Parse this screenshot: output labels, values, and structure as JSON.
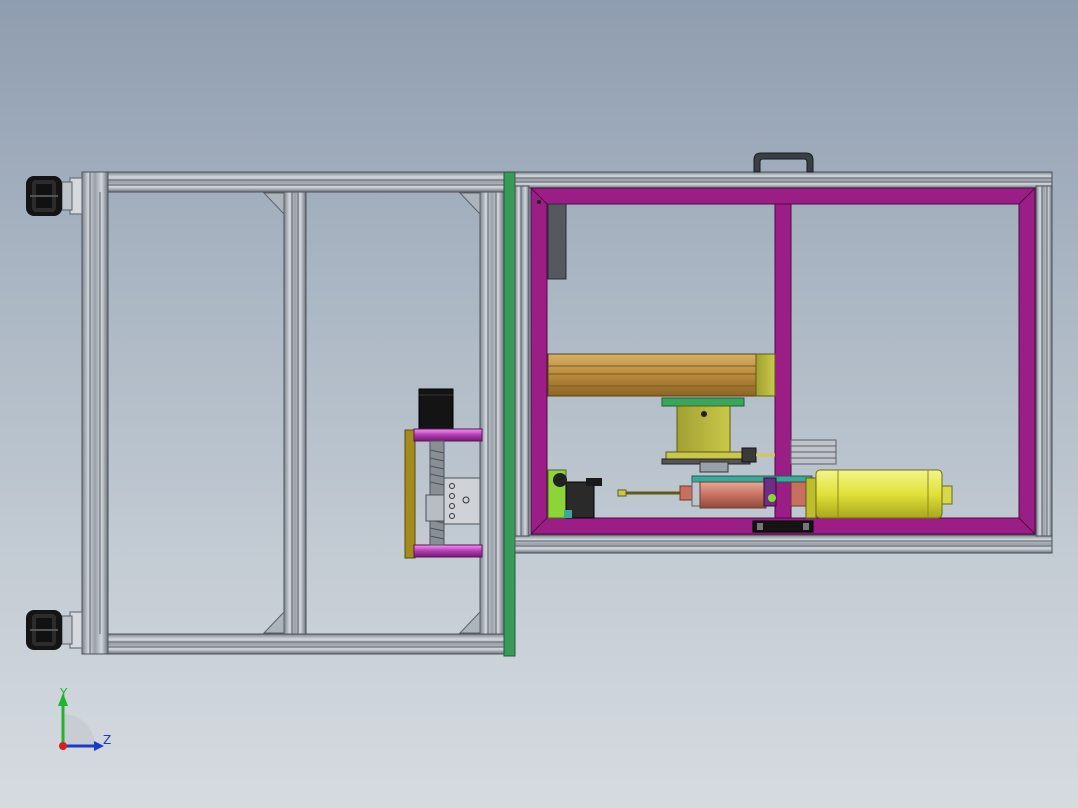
{
  "viewport": {
    "background_top": "#8f9db0",
    "background_bottom": "#d6dbe0"
  },
  "colors": {
    "extrusion": "#b4bac3",
    "extrusion_dark": "#5b6069",
    "inner_frame": "#9b1e86",
    "green_panel": "#3a9a5a",
    "gold_plate": "#a38c1a",
    "yellow_motor": "#e6e64a",
    "copper_cylinder": "#c9776a",
    "lime": "#8dd33a",
    "teal": "#3aa99a",
    "black": "#141414"
  },
  "parts": {
    "left_frame": "aluminum-extrusion-frame",
    "right_frame": "aluminum-extrusion-frame",
    "caster_top": "caster-wheel",
    "caster_bottom": "caster-wheel",
    "handle": "door-handle",
    "stepper": "stepper-motor",
    "ball_screw": "ball-screw",
    "linear_module": "linear-module",
    "cylinder": "pneumatic-cylinder",
    "yellow_motor": "servo-motor"
  },
  "triad": {
    "y_label": "Y",
    "z_label": "Z"
  }
}
